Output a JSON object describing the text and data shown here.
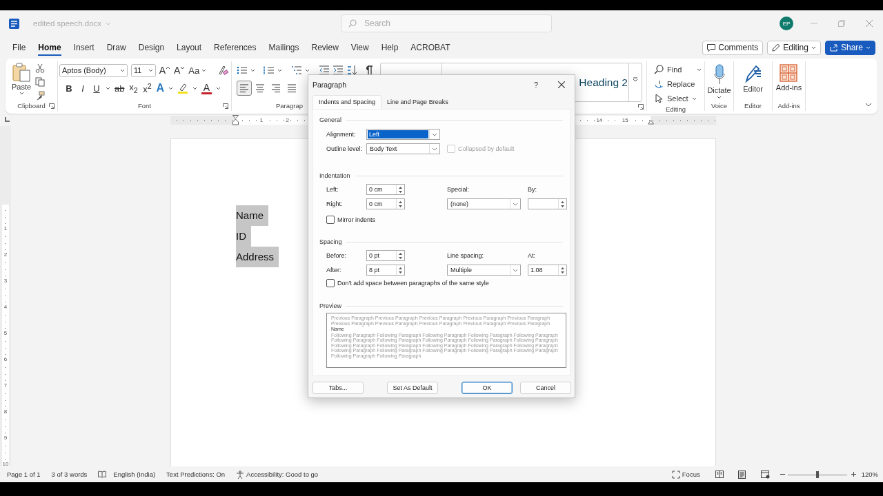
{
  "title_bar": {
    "file_name": "edited speech.docx",
    "search_placeholder": "Search",
    "avatar": "EP"
  },
  "menu_tabs": [
    {
      "label": "File",
      "selected": false
    },
    {
      "label": "Home",
      "selected": true
    },
    {
      "label": "Insert",
      "selected": false
    },
    {
      "label": "Draw",
      "selected": false
    },
    {
      "label": "Design",
      "selected": false
    },
    {
      "label": "Layout",
      "selected": false
    },
    {
      "label": "References",
      "selected": false
    },
    {
      "label": "Mailings",
      "selected": false
    },
    {
      "label": "Review",
      "selected": false
    },
    {
      "label": "View",
      "selected": false
    },
    {
      "label": "Help",
      "selected": false
    },
    {
      "label": "ACROBAT",
      "selected": false
    }
  ],
  "header_buttons": [
    {
      "label": "Comments",
      "kind": "comments"
    },
    {
      "label": "Editing",
      "kind": "editing"
    },
    {
      "label": "Share",
      "kind": "share"
    }
  ],
  "ribbon": {
    "clipboard": {
      "paste": "Paste",
      "label": "Clipboard"
    },
    "font": {
      "family": "Aptos (Body)",
      "size": "11",
      "label": "Font",
      "tools": [
        {
          "label": "A",
          "kind": "grow"
        },
        {
          "label": "A",
          "kind": "shrink"
        },
        {
          "label": "Aa",
          "kind": "case"
        }
      ],
      "format": [
        {
          "label": "B",
          "kind": "bold"
        },
        {
          "label": "I",
          "kind": "italic"
        },
        {
          "label": "U",
          "kind": "underline"
        },
        {
          "label": "ab",
          "kind": "strike"
        },
        {
          "label": "x$_{2}$",
          "kind": "subscript"
        },
        {
          "label": "x$^{2}$",
          "kind": "superscript"
        }
      ],
      "colors": [
        {
          "label": "A",
          "kind": "effects",
          "color": "#2b79c2"
        },
        {
          "kind": "highlight",
          "color": "#f2e21c"
        },
        {
          "label": "A",
          "kind": "font_color",
          "color": "#c8202a"
        }
      ]
    },
    "paragraph": {
      "label": "Paragrap",
      "alignments": [
        {
          "kind": "left",
          "selected": true
        },
        {
          "kind": "center",
          "selected": false
        },
        {
          "kind": "right",
          "selected": false
        },
        {
          "kind": "justify",
          "selected": false
        }
      ]
    },
    "styles": {
      "visible_style": "Heading 2"
    },
    "editing": {
      "label": "Editing",
      "items": [
        {
          "label": "Find",
          "kind": "find"
        },
        {
          "label": "Replace",
          "kind": "replace"
        },
        {
          "label": "Select",
          "kind": "select"
        }
      ]
    },
    "groups": [
      {
        "button": "Dictate",
        "label": "Voice",
        "kind": "dictate"
      },
      {
        "button": "Editor",
        "label": "Editor",
        "kind": "editor"
      },
      {
        "button": "Add-ins",
        "label": "Add-ins",
        "kind": "addins"
      }
    ]
  },
  "ruler": {
    "left_numbers": [
      "1",
      "2"
    ],
    "right_numbers": [
      "14",
      "15"
    ],
    "vertical_numbers": [
      "1",
      "2",
      "3",
      "4",
      "5",
      "6",
      "7",
      "8",
      "9",
      "10"
    ]
  },
  "document": {
    "paragraphs": [
      {
        "text": "Name",
        "selected": true
      },
      {
        "text": "ID",
        "selected": true
      },
      {
        "text": "Address",
        "selected": true
      }
    ]
  },
  "status_bar": {
    "page": "Page 1 of 1",
    "words": "3 of 3 words",
    "language": "English (India)",
    "predictions": "Text Predictions: On",
    "accessibility": "Accessibility: Good to go",
    "focus": "Focus",
    "zoom": {
      "level": 0.5,
      "reading": "120%"
    }
  },
  "dialog": {
    "title": "Paragraph",
    "help": "?",
    "tabs": [
      {
        "label": "Indents and Spacing",
        "selected": true
      },
      {
        "label": "Line and Page Breaks",
        "selected": false
      }
    ],
    "general": {
      "heading": "General",
      "alignment": {
        "label": "Alignment:",
        "value": "Left",
        "selected": true
      },
      "outline": {
        "label": "Outline level:",
        "value": "Body Text"
      },
      "collapsed": {
        "label": "Collapsed by default",
        "checked": false,
        "disabled": true
      }
    },
    "indentation": {
      "heading": "Indentation",
      "left": {
        "label": "Left:",
        "value": "0 cm"
      },
      "right": {
        "label": "Right:",
        "value": "0 cm"
      },
      "special": {
        "label": "Special:",
        "value": "(none)"
      },
      "by": {
        "label": "By:"
      },
      "mirror": {
        "label": "Mirror indents",
        "checked": false,
        "disabled": false
      }
    },
    "spacing": {
      "heading": "Spacing",
      "before": {
        "label": "Before:",
        "value": "0 pt"
      },
      "after": {
        "label": "After:",
        "value": "8 pt"
      },
      "line_spacing": {
        "label": "Line spacing:",
        "value": "Multiple"
      },
      "at": {
        "label": "At:",
        "value": "1.08"
      },
      "dont_add": {
        "label": "Don't add space between paragraphs of the same style",
        "checked": false,
        "disabled": false
      }
    },
    "preview": {
      "heading": "Preview",
      "previous": "Previous Paragraph Previous Paragraph Previous Paragraph Previous Paragraph Previous Paragraph Previous Paragraph Previous Paragraph Previous Paragraph Previous Paragraph Previous Paragraph",
      "sample": "Name",
      "following": "Following Paragraph Following Paragraph Following Paragraph Following Paragraph Following Paragraph Following Paragraph Following Paragraph Following Paragraph Following Paragraph Following Paragraph Following Paragraph Following Paragraph Following Paragraph Following Paragraph Following Paragraph Following Paragraph Following Paragraph Following Paragraph Following Paragraph Following Paragraph Following Paragraph Following Paragraph"
    },
    "buttons": [
      {
        "label": "Tabs...",
        "kind": "plain"
      },
      {
        "label": "Set As Default",
        "kind": "plain"
      },
      {
        "label": "OK",
        "kind": "default"
      },
      {
        "label": "Cancel",
        "kind": "plain"
      }
    ]
  }
}
